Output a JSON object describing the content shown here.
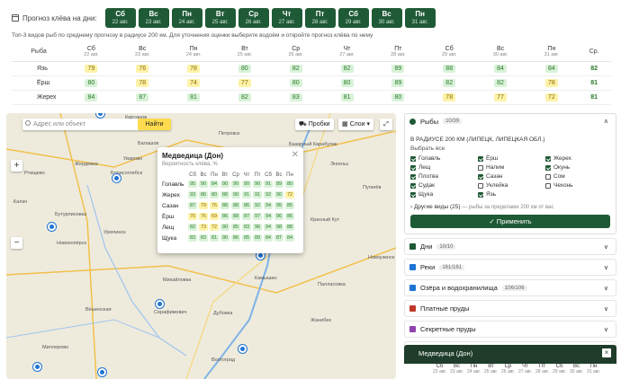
{
  "header": {
    "label": "Прогноз клёва на дни:",
    "days": [
      {
        "d": "Сб",
        "date": "22 авг."
      },
      {
        "d": "Вс",
        "date": "23 авг."
      },
      {
        "d": "Пн",
        "date": "24 авг."
      },
      {
        "d": "Вт",
        "date": "25 авг."
      },
      {
        "d": "Ср",
        "date": "26 авг."
      },
      {
        "d": "Чт",
        "date": "27 авг."
      },
      {
        "d": "Пт",
        "date": "28 авг."
      },
      {
        "d": "Сб",
        "date": "29 авг."
      },
      {
        "d": "Вс",
        "date": "30 авг."
      },
      {
        "d": "Пн",
        "date": "31 авг."
      }
    ],
    "subtitle": "Топ-3 видов рыб по среднему прогнозу в радиусе 200 км. Для уточнения оценки выберите водоём и откройте прогноз клёва по нему"
  },
  "top_table": {
    "fish_col": "Рыба",
    "avg_col": "Ср.",
    "rows": [
      {
        "fish": "Язь",
        "vals": [
          79,
          76,
          78,
          80,
          82,
          82,
          89,
          88,
          84,
          84
        ],
        "avg": 82
      },
      {
        "fish": "Ёрш",
        "vals": [
          80,
          78,
          74,
          77,
          80,
          80,
          89,
          82,
          82,
          78
        ],
        "avg": 81
      },
      {
        "fish": "Жерех",
        "vals": [
          84,
          87,
          81,
          82,
          83,
          81,
          80,
          78,
          77,
          72
        ],
        "avg": 81
      }
    ]
  },
  "map": {
    "search_placeholder": "Адрес или объект",
    "find_label": "Найти",
    "traffic_label": "Пробки",
    "layers_label": "Слои",
    "zoom_in": "+",
    "zoom_out": "−",
    "towns": [
      {
        "name": "Кирсанов"
      },
      {
        "name": "Петровск"
      },
      {
        "name": "Балашов"
      },
      {
        "name": "Борисоглебск"
      },
      {
        "name": "Бутурлиновка"
      },
      {
        "name": "Урюпинск"
      },
      {
        "name": "Михайловка"
      },
      {
        "name": "Камышин"
      },
      {
        "name": "Серафимович"
      },
      {
        "name": "Волгоград"
      },
      {
        "name": "Миллерово"
      },
      {
        "name": "Вёшенская"
      },
      {
        "name": "Жирновск"
      },
      {
        "name": "Красный Кут"
      },
      {
        "name": "Палласовка"
      },
      {
        "name": "Новоузенск"
      },
      {
        "name": "Жанибек"
      },
      {
        "name": "Энгельс"
      },
      {
        "name": "Пугачёв"
      },
      {
        "name": "Калач"
      },
      {
        "name": "Котово"
      },
      {
        "name": "Жердевка"
      },
      {
        "name": "Уварово"
      },
      {
        "name": "Аткарск"
      },
      {
        "name": "Новохопёрск"
      },
      {
        "name": "Фролово"
      },
      {
        "name": "Дубовка"
      },
      {
        "name": "Базарный Карабулак"
      },
      {
        "name": "Лысые Горы"
      },
      {
        "name": "Ртищево"
      }
    ],
    "popup": {
      "title": "Медведица (Дон)",
      "subtitle": "Вероятность клёва, %",
      "days": [
        "Сб",
        "Вс",
        "Пн",
        "Вт",
        "Ср",
        "Чт",
        "Пт",
        "Сб",
        "Вс",
        "Пн"
      ],
      "rows": [
        {
          "fish": "Голавль",
          "vals": [
            95,
            90,
            84,
            90,
            90,
            90,
            90,
            91,
            89,
            80
          ]
        },
        {
          "fish": "Жерех",
          "vals": [
            93,
            86,
            80,
            88,
            90,
            91,
            91,
            92,
            90,
            72
          ]
        },
        {
          "fish": "Сазан",
          "vals": [
            87,
            79,
            76,
            88,
            88,
            86,
            92,
            94,
            95,
            85
          ]
        },
        {
          "fish": "Ёрш",
          "vals": [
            76,
            76,
            69,
            86,
            88,
            87,
            97,
            94,
            96,
            86
          ]
        },
        {
          "fish": "Лещ",
          "vals": [
            82,
            73,
            72,
            90,
            85,
            83,
            96,
            94,
            98,
            88
          ]
        },
        {
          "fish": "Щука",
          "vals": [
            83,
            83,
            81,
            90,
            86,
            85,
            89,
            84,
            87,
            84
          ]
        }
      ]
    }
  },
  "sidebar": {
    "fish": {
      "title": "Рыбы",
      "count": "10/39",
      "radius": "В РАДИУСЕ 200 КМ (ЛИПЕЦК, ЛИПЕЦКАЯ ОБЛ.)",
      "select_all": "Выбрать все",
      "items": [
        {
          "name": "Голавль",
          "on": true
        },
        {
          "name": "Ёрш",
          "on": true
        },
        {
          "name": "Жерех",
          "on": true
        },
        {
          "name": "Лещ",
          "on": true
        },
        {
          "name": "Налим",
          "on": false
        },
        {
          "name": "Окунь",
          "on": true
        },
        {
          "name": "Плотва",
          "on": true
        },
        {
          "name": "Сазан",
          "on": true
        },
        {
          "name": "Сом",
          "on": false
        },
        {
          "name": "Судак",
          "on": true
        },
        {
          "name": "Уклейка",
          "on": false
        },
        {
          "name": "Чехонь",
          "on": false
        },
        {
          "name": "Щука",
          "on": true
        },
        {
          "name": "Язь",
          "on": true
        }
      ],
      "other_label": "Другие виды (25)",
      "other_note": "— рыбы за пределами 200 км от вас",
      "apply_label": "Применить"
    },
    "sections": [
      {
        "title": "Дни",
        "count": "10/10",
        "color": "#1f5a36"
      },
      {
        "title": "Реки",
        "count": "161/161",
        "color": "#1e73d4"
      },
      {
        "title": "Озёра и водохранилища",
        "count": "106/106",
        "color": "#1e73d4"
      },
      {
        "title": "Платные пруды",
        "count": "",
        "color": "#c0392b"
      },
      {
        "title": "Секретные пруды",
        "count": "",
        "color": "#8e44ad"
      },
      {
        "title": "Базы и кемпинги",
        "count": "",
        "color": "#e74c3c"
      }
    ],
    "bottom": {
      "title": "Медведица (Дон)",
      "close": "×",
      "days": [
        {
          "d": "Сб",
          "date": "22 авг."
        },
        {
          "d": "Вс",
          "date": "23 авг."
        },
        {
          "d": "Пн",
          "date": "24 авг."
        },
        {
          "d": "Вт",
          "date": "25 авг."
        },
        {
          "d": "Ср",
          "date": "26 авг."
        },
        {
          "d": "Чт",
          "date": "27 авг."
        },
        {
          "d": "Пт",
          "date": "28 авг."
        },
        {
          "d": "Сб",
          "date": "29 авг."
        },
        {
          "d": "Вс",
          "date": "30 авг."
        },
        {
          "d": "Пн",
          "date": "31 авг."
        }
      ]
    }
  }
}
